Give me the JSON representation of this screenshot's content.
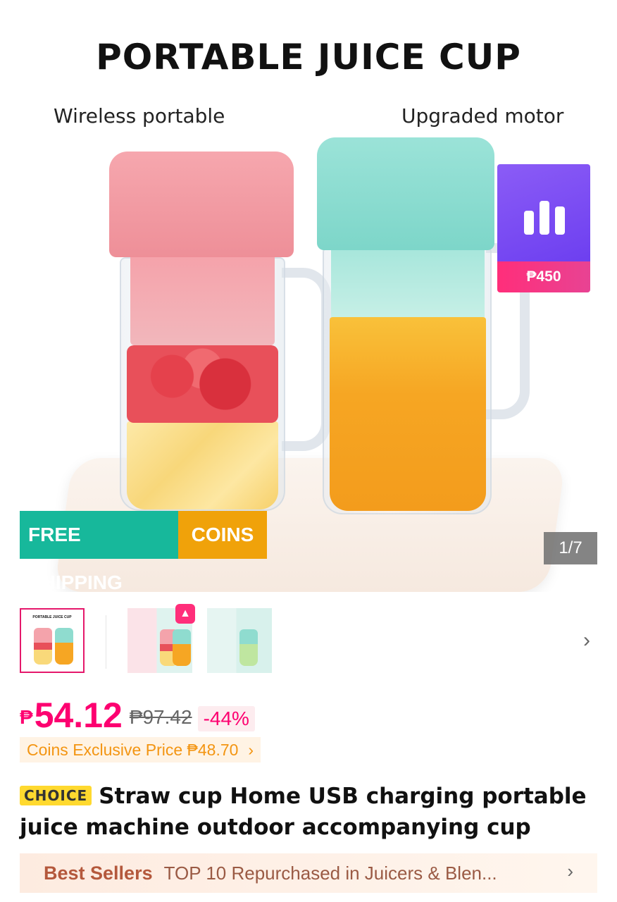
{
  "hero": {
    "title": "PORTABLE JUICE CUP",
    "caption_left": "Wireless portable",
    "caption_right": "Upgraded motor",
    "promo_price": "₱450",
    "badge_free_shipping": "FREE SHIPPING",
    "badge_coins": "COINS",
    "image_counter": "1/7"
  },
  "thumbnails": {
    "count_visible": 3,
    "selected_index": 0,
    "next_icon": "chevron-right-icon",
    "fire_icon": "fire-icon",
    "mini_title": "PORTABLE JUICE CUP"
  },
  "price": {
    "currency_symbol": "₱",
    "current": "54.12",
    "original": "₱97.42",
    "discount": "-44%",
    "coins_exclusive": "Coins Exclusive Price ₱48.70",
    "coins_chevron": "›"
  },
  "product": {
    "tag": "CHOICE",
    "title": "Straw cup Home USB charging portable juice machine outdoor accompanying cup"
  },
  "best_sellers": {
    "label": "Best Sellers",
    "text": "TOP 10 Repurchased in Juicers & Blen...",
    "chevron": "›"
  },
  "colors": {
    "accent": "#fd0070",
    "free_shipping": "#17b89b",
    "coins": "#f0a20a",
    "promo_purple": "#7c4ef2"
  }
}
